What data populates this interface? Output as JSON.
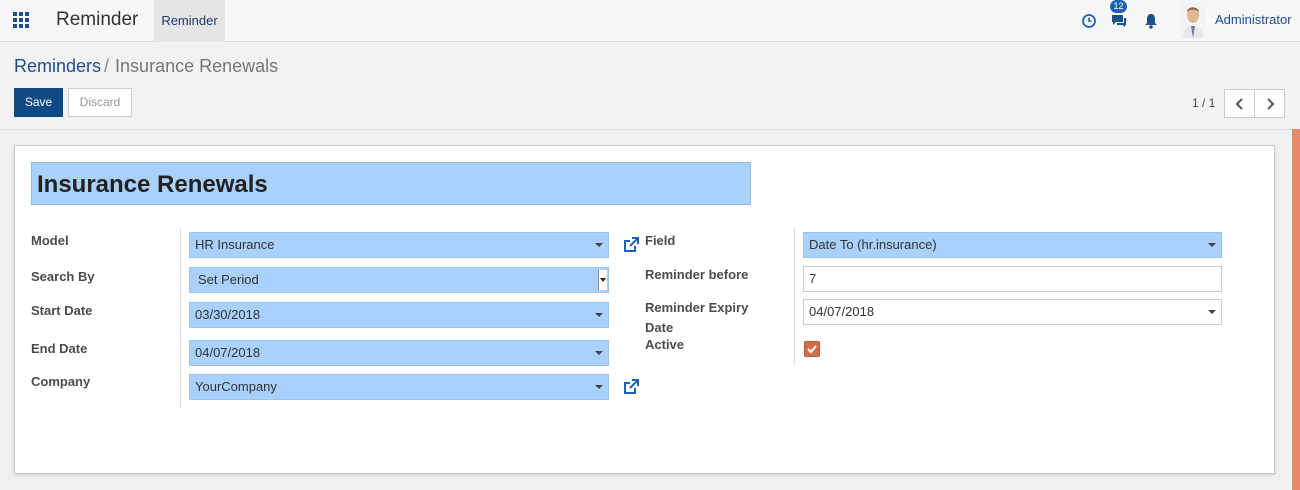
{
  "navbar": {
    "app_title": "Reminder",
    "menu_item": "Reminder",
    "message_count": "12",
    "user_name": "Administrator",
    "icons": [
      "apps-grid-icon",
      "clock-icon",
      "chat-icon",
      "bell-icon"
    ]
  },
  "breadcrumb": {
    "parent": "Reminders",
    "separator": "/",
    "current": "Insurance Renewals"
  },
  "buttons": {
    "save": "Save",
    "discard": "Discard"
  },
  "pager": {
    "value": "1 / 1"
  },
  "form": {
    "name": "Insurance Renewals",
    "labels": {
      "model": "Model",
      "search_by": "Search By",
      "start_date": "Start Date",
      "end_date": "End Date",
      "company": "Company",
      "field": "Field",
      "reminder_before": "Reminder before",
      "reminder_expiry_1": "Reminder Expiry",
      "reminder_expiry_2": "Date",
      "active": "Active"
    },
    "values": {
      "model": "HR Insurance",
      "search_by": "Set Period",
      "start_date": "03/30/2018",
      "end_date": "04/07/2018",
      "company": "YourCompany",
      "field": "Date To (hr.insurance)",
      "reminder_before": "7",
      "reminder_expiry": "04/07/2018",
      "active": true
    }
  },
  "colors": {
    "primary": "#0f4a85",
    "required_field": "#a9d1fb",
    "accent": "#d06f47"
  }
}
